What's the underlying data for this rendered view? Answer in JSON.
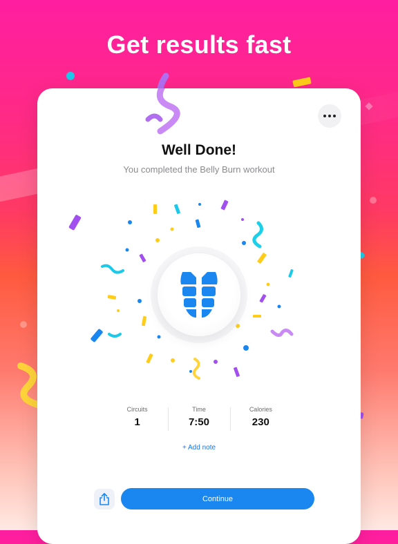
{
  "headline": "Get results fast",
  "card": {
    "title": "Well Done!",
    "subtitle": "You completed the Belly Burn workout",
    "stats": [
      {
        "label": "Circuits",
        "value": "1"
      },
      {
        "label": "Time",
        "value": "7:50"
      },
      {
        "label": "Calories",
        "value": "230"
      }
    ],
    "add_note": "+ Add note",
    "continue": "Continue"
  },
  "colors": {
    "accent": "#1a86f0",
    "gradient_top": "#ff1ea0",
    "gradient_mid": "#ff5a3f",
    "gradient_bottom": "#ffe9e3"
  },
  "icons": {
    "menu": "ellipsis-icon",
    "share": "share-icon",
    "workout": "abs-icon"
  }
}
